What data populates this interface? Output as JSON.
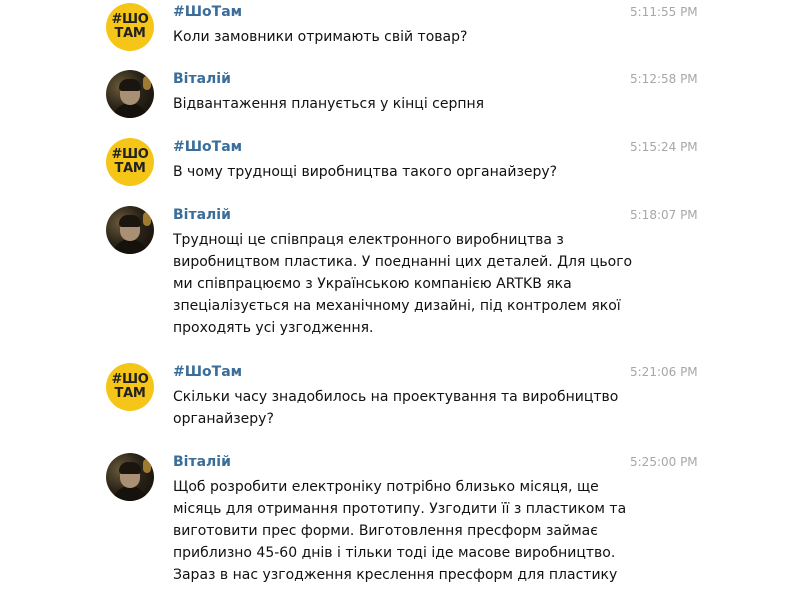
{
  "messages": [
    {
      "sender": "#ШоТам",
      "time": "5:11:55 PM",
      "avatar": {
        "type": "brand-logo",
        "line1": "#ШО",
        "line2": "ТАМ",
        "color": "#f5c518"
      },
      "lines": [
        "Коли замовники отримають свій товар?"
      ]
    },
    {
      "sender": "Віталій",
      "time": "5:12:58 PM",
      "avatar": {
        "type": "user-photo"
      },
      "lines": [
        "Відвантаження планується у кінці серпня"
      ]
    },
    {
      "sender": "#ШоТам",
      "time": "5:15:24 PM",
      "avatar": {
        "type": "brand-logo",
        "line1": "#ШО",
        "line2": "ТАМ",
        "color": "#f5c518"
      },
      "lines": [
        "В чому труднощі виробництва такого органайзеру?"
      ]
    },
    {
      "sender": "Віталій",
      "time": "5:18:07 PM",
      "avatar": {
        "type": "user-photo"
      },
      "lines": [
        "Труднощі це співпраця електронного виробництва з",
        "виробництвом пластика. У поеднанні цих деталей. Для цього",
        "ми співпрацюємо з Українською компанією ARTKB яка",
        "зпеціалізується на механічному дизайні, під контролем якої",
        "проходять усі узгодження."
      ]
    },
    {
      "sender": "#ШоТам",
      "time": "5:21:06 PM",
      "avatar": {
        "type": "brand-logo",
        "line1": "#ШО",
        "line2": "ТАМ",
        "color": "#f5c518"
      },
      "lines": [
        "Скільки часу знадобилось на проектування та виробництво",
        "органайзеру?"
      ]
    },
    {
      "sender": "Віталій",
      "time": "5:25:00 PM",
      "avatar": {
        "type": "user-photo"
      },
      "lines": [
        "Щоб розробити електроніку потрібно близько місяця, ще",
        "місяць для отримання прототипу. Узгодити її з пластиком та",
        "виготовити прес форми. Виготовлення пресформ займає",
        "приблизно 45-60 днів і тільки тоді іде масове виробництво.",
        "Зараз в нас узгодження креслення пресформ для пластику"
      ]
    }
  ],
  "colors": {
    "sender": "#3a6d99",
    "timestamp": "#a7a7a7",
    "text": "#111111",
    "brand_avatar": "#f5c518"
  }
}
